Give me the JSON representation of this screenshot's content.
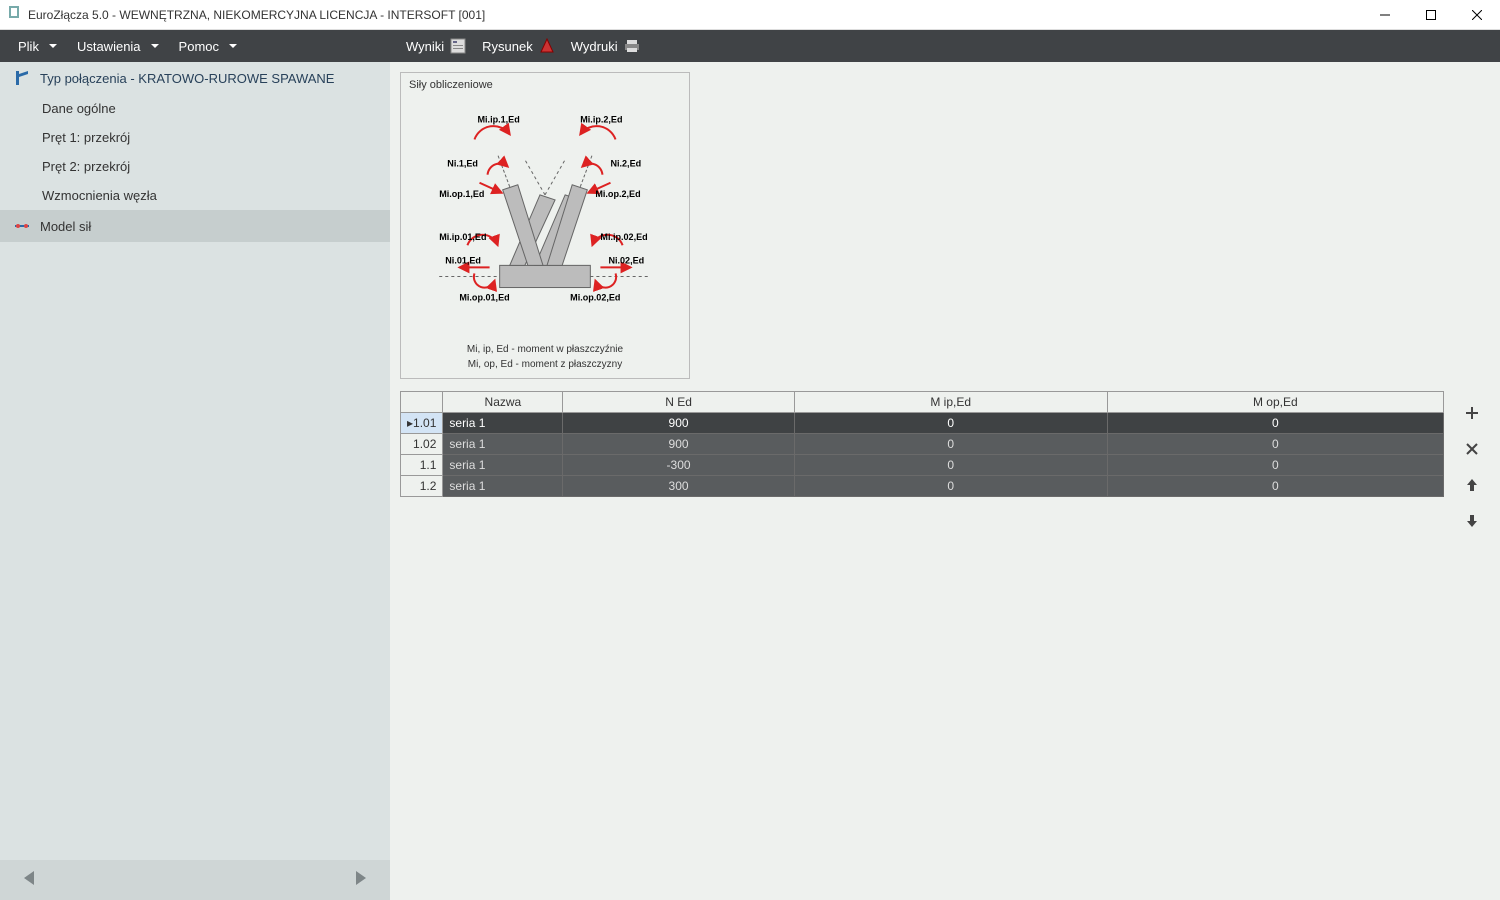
{
  "window": {
    "title": "EuroZłącza 5.0 - WEWNĘTRZNA, NIEKOMERCYJNA LICENCJA - INTERSOFT [001]"
  },
  "menu": {
    "items": [
      "Plik",
      "Ustawienia",
      "Pomoc"
    ]
  },
  "sidebar": {
    "header": "Typ połączenia - KRATOWO-RUROWE SPAWANE",
    "items": [
      "Dane ogólne",
      "Pręt 1: przekrój",
      "Pręt 2: przekrój",
      "Wzmocnienia węzła"
    ],
    "active": "Model sił"
  },
  "toolbar": {
    "results": "Wyniki",
    "drawing": "Rysunek",
    "printouts": "Wydruki"
  },
  "diagram": {
    "title": "Siły obliczeniowe",
    "labels": {
      "mi_ip_1": "Mi.ip.1,Ed",
      "mi_ip_2": "Mi.ip.2,Ed",
      "ni_1": "Ni.1,Ed",
      "ni_2": "Ni.2,Ed",
      "mi_op_1": "Mi.op.1,Ed",
      "mi_op_2": "Mi.op.2,Ed",
      "mi_ip_01": "Mi.ip.01,Ed",
      "mi_ip_02": "Mi.ip.02,Ed",
      "ni_01": "Ni.01,Ed",
      "ni_02": "Ni.02,Ed",
      "mi_op_01": "Mi.op.01,Ed",
      "mi_op_02": "Mi.op.02,Ed"
    },
    "caption1": "Mi, ip, Ed - moment w płaszczyźnie",
    "caption2": "Mi, op, Ed - moment z płaszczyzny"
  },
  "table": {
    "headers": {
      "name": "Nazwa",
      "n_ed": "N Ed",
      "m_ip": "M ip,Ed",
      "m_op": "M op,Ed"
    },
    "rows": [
      {
        "id": "▸1.01",
        "name": "seria 1",
        "n": "900",
        "mip": "0",
        "mop": "0",
        "selected": true
      },
      {
        "id": "1.02",
        "name": "seria 1",
        "n": "900",
        "mip": "0",
        "mop": "0",
        "selected": false
      },
      {
        "id": "1.1",
        "name": "seria 1",
        "n": "-300",
        "mip": "0",
        "mop": "0",
        "selected": false
      },
      {
        "id": "1.2",
        "name": "seria 1",
        "n": "300",
        "mip": "0",
        "mop": "0",
        "selected": false
      }
    ]
  }
}
